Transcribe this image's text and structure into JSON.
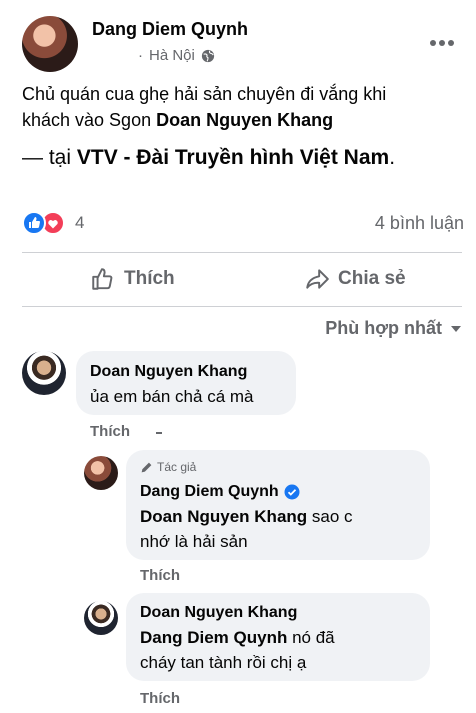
{
  "post": {
    "author": "Dang Diem Quynh",
    "location": "Hà Nội",
    "text_line1": "Chủ quán cua ghẹ hải sản chuyên đi vắng khi",
    "text_line2_prefix": "khách vào Sgon ",
    "text_line2_mention": "Doan Nguyen Khang",
    "checkin_prefix": "— tại ",
    "checkin_place": "VTV - Đài Truyền hình Việt Nam",
    "checkin_suffix": ".",
    "reaction_count": "4",
    "comment_count": "4 bình luận"
  },
  "actions": {
    "like": "Thích",
    "share": "Chia sẻ",
    "sort": "Phù hợp nhất"
  },
  "comments": [
    {
      "author": "Doan Nguyen Khang",
      "text": "ủa em bán chả cá mà",
      "like": "Thích"
    }
  ],
  "replies": [
    {
      "badge": "Tác giả",
      "author": "Dang Diem Quynh",
      "mention": "Doan Nguyen Khang",
      "text_after_mention": " sao c",
      "text_line2": "nhớ là hải sản",
      "like": "Thích"
    },
    {
      "author": "Doan Nguyen Khang",
      "mention": "Dang Diem Quynh",
      "text_after_mention": " nó đã",
      "text_line2": "cháy tan tành rồi chị ạ",
      "like": "Thích"
    }
  ],
  "colors": {
    "like_blue": "#1877f2",
    "love_red": "#f33e58",
    "verified_blue": "#1877f2"
  },
  "icons": [
    "globe-icon",
    "more-icon",
    "like-reaction-icon",
    "love-reaction-icon",
    "thumbs-up-icon",
    "share-icon",
    "chevron-down-icon",
    "pencil-icon",
    "verified-icon"
  ]
}
